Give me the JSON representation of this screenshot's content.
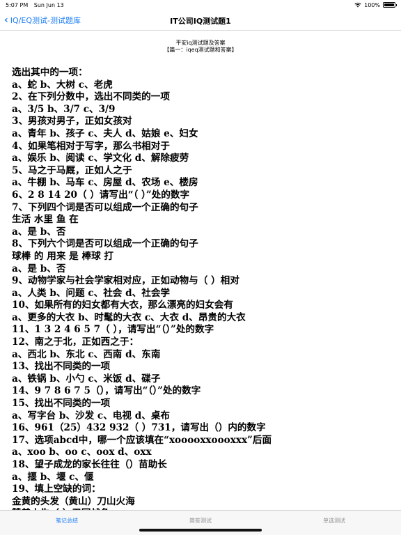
{
  "status": {
    "time": "5:07 PM",
    "date": "Sun Jun 13",
    "battery": "100%",
    "battery_level": 1.0,
    "icons": [
      "wifi-icon",
      "battery-icon"
    ]
  },
  "nav": {
    "back_label": "IQ/EQ测试-测试题库",
    "title": "IT公司IQ测试题1"
  },
  "doc": {
    "heading": "平安iq测试题及答案",
    "subheading": "【篇一：iqeq测试题和答案】",
    "lines": [
      "选出其中的一项：",
      "a、蛇 b、大树 c、老虎",
      "2、在下列分数中，选出不同类的一项",
      "a、3/5 b、3/7 c、3/9",
      "3、男孩对男子，正如女孩对",
      "a、青年 b、孩子 c、夫人 d、姑娘 e、妇女",
      "4、如果笔相对于写字，那么书相对于",
      "a、娱乐 b、阅读 c、学文化 d、解除疲劳",
      "5、马之于马厩，正如人之于",
      "a、牛棚 b、马车 c、房屋 d、农场 e、楼房",
      "6、2 8 14 20（ ）请写出“（ ）”处的数字",
      "7、下列四个词是否可以组成一个正确的句子",
      "生活 水里 鱼 在",
      "a、是 b、否",
      "8、下列六个词是否可以组成一个正确的句子",
      "球棒 的 用来 是 棒球 打",
      "a、是 b、否",
      "9、动物学家与社会学家相对应，正如动物与（ ）相对",
      "a、人类 b、问题 c、社会 d、社会学",
      "10、如果所有的妇女都有大衣，那么漂亮的妇女会有",
      "a、更多的大衣 b、时髦的大衣 c、大衣 d、昂贵的大衣",
      "11、1 3 2 4 6 5 7（ ），请写出“（）”处的数字",
      "12、南之于北，正如西之于：",
      "a、西北 b、东北 c、西南 d、东南",
      "13、找出不同类的一项",
      "a、铁锅 b、小勺 c、米饭 d、碟子",
      "14、9 7 8 6 7 5（），请写出“（）”处的数字",
      "15、找出不同类的一项",
      "a、写字台 b、沙发 c、电视 d、桌布",
      "16、961（25）432 932（ ）731，请写出（）内的数字",
      "17、选项abcd中，哪一个应该填在“xooooxxoooxxx”后面",
      "a、xoo b、oo c、oox d、oxx",
      "18、望子成龙的家长往往（）苗助长",
      "a、揠 b、堰 c、偃",
      "19、填上空缺的词：",
      "金黄的头发（黄山）刀山火海",
      "赞美人生（ ）卫国战争"
    ]
  },
  "tabs": [
    {
      "label": "笔记总结",
      "active": true
    },
    {
      "label": "简答测试",
      "active": false
    },
    {
      "label": "单选测试",
      "active": false
    }
  ],
  "colors": {
    "accent": "#1a7cf5",
    "inactive_tab": "#8e8e93"
  }
}
